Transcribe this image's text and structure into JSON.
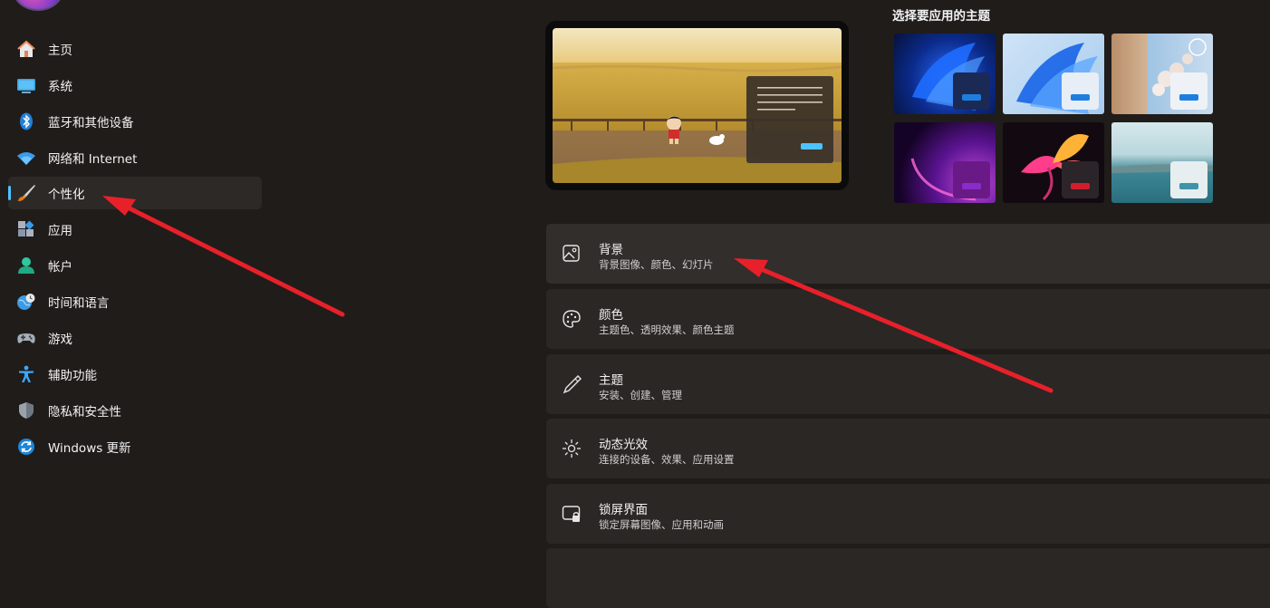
{
  "sidebar": {
    "items": [
      {
        "label": "主页",
        "icon": "home-icon"
      },
      {
        "label": "系统",
        "icon": "system-icon"
      },
      {
        "label": "蓝牙和其他设备",
        "icon": "bluetooth-icon"
      },
      {
        "label": "网络和 Internet",
        "icon": "wifi-icon"
      },
      {
        "label": "个性化",
        "icon": "brush-icon",
        "active": true
      },
      {
        "label": "应用",
        "icon": "apps-icon"
      },
      {
        "label": "帐户",
        "icon": "account-icon"
      },
      {
        "label": "时间和语言",
        "icon": "globe-clock-icon"
      },
      {
        "label": "游戏",
        "icon": "gamepad-icon"
      },
      {
        "label": "辅助功能",
        "icon": "accessibility-icon"
      },
      {
        "label": "隐私和安全性",
        "icon": "shield-icon"
      },
      {
        "label": "Windows 更新",
        "icon": "update-icon"
      }
    ]
  },
  "themes": {
    "title": "选择要应用的主题"
  },
  "cards": [
    {
      "title": "背景",
      "subtitle": "背景图像、颜色、幻灯片",
      "icon": "image-icon"
    },
    {
      "title": "颜色",
      "subtitle": "主题色、透明效果、颜色主题",
      "icon": "palette-icon"
    },
    {
      "title": "主题",
      "subtitle": "安装、创建、管理",
      "icon": "pen-icon"
    },
    {
      "title": "动态光效",
      "subtitle": "连接的设备、效果、应用设置",
      "icon": "sparkle-icon"
    },
    {
      "title": "锁屏界面",
      "subtitle": "锁定屏幕图像、应用和动画",
      "icon": "lock-screen-icon"
    }
  ],
  "colors": {
    "accent": "#4cc2ff",
    "arrow": "#e8202a"
  }
}
